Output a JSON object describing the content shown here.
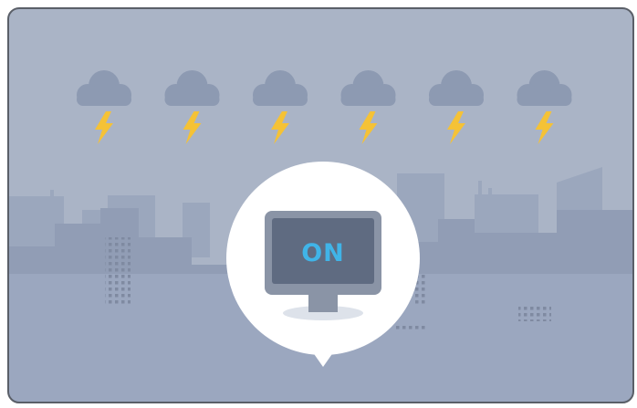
{
  "scene": {
    "monitor_status": "ON",
    "icons": [
      "storm-cloud-icon",
      "lightning-bolt-icon",
      "city-skyline",
      "monitor-icon",
      "speech-bubble"
    ]
  },
  "colors": {
    "sky": "#aab4c6",
    "city_light": "#9aa6bd",
    "city_dark": "#8f9bb3",
    "cloud": "#8d9ab2",
    "lightning": "#f5c236",
    "bubble": "#ffffff",
    "monitor_frame": "#8a94a6",
    "monitor_screen": "#5f6b81",
    "status_text": "#40b4e8"
  }
}
